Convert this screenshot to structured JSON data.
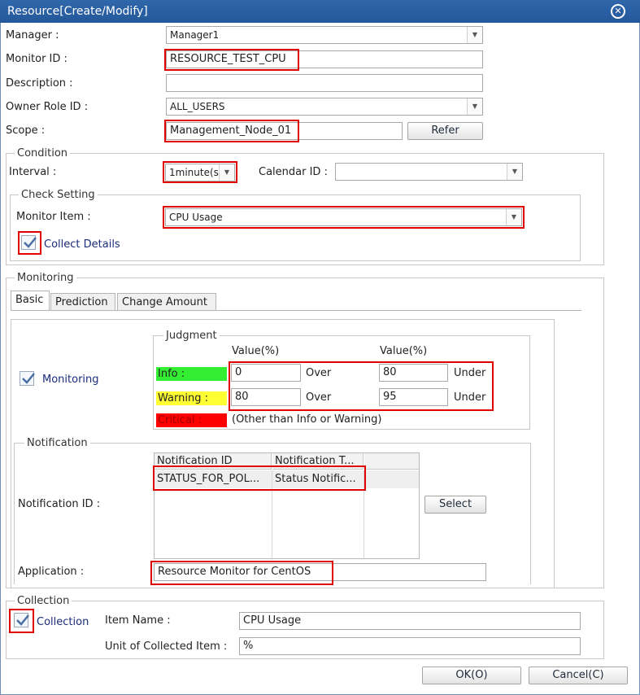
{
  "window": {
    "title": "Resource[Create/Modify]"
  },
  "form": {
    "manager_label": "Manager :",
    "manager_value": "Manager1",
    "monitor_id_label": "Monitor ID :",
    "monitor_id_value": "RESOURCE_TEST_CPU",
    "description_label": "Description :",
    "description_value": "",
    "owner_role_label": "Owner Role ID :",
    "owner_role_value": "ALL_USERS",
    "scope_label": "Scope :",
    "scope_value": "Management_Node_01",
    "refer_label": "Refer"
  },
  "condition": {
    "legend": "Condition",
    "interval_label": "Interval :",
    "interval_value": "1minute(s",
    "calendar_label": "Calendar ID :",
    "calendar_value": "",
    "check_setting": {
      "legend": "Check Setting",
      "monitor_item_label": "Monitor Item :",
      "monitor_item_value": "CPU Usage",
      "collect_details_label": "Collect Details",
      "collect_details_checked": true
    }
  },
  "monitoring": {
    "legend": "Monitoring",
    "tabs": [
      {
        "label": "Basic",
        "active": true
      },
      {
        "label": "Prediction",
        "active": false
      },
      {
        "label": "Change Amount",
        "active": false
      }
    ],
    "monitoring_label": "Monitoring",
    "monitoring_checked": true,
    "judgment": {
      "legend": "Judgment",
      "col1_header": "Value(%)",
      "col2_header": "Value(%)",
      "info_label": "Info :",
      "info_lower": "0",
      "info_over": "Over",
      "info_upper": "80",
      "info_under": "Under",
      "warning_label": "Warning :",
      "warning_lower": "80",
      "warning_over": "Over",
      "warning_upper": "95",
      "warning_under": "Under",
      "critical_label": "Critical :",
      "critical_note": "(Other than Info or Warning)",
      "colors": {
        "info": "#33ee33",
        "warning": "#ffff33",
        "critical": "#ff0000"
      }
    },
    "notification": {
      "legend": "Notification",
      "notification_id_label": "Notification ID :",
      "columns": [
        "Notification ID",
        "Notification T..."
      ],
      "rows": [
        {
          "id": "STATUS_FOR_POL...",
          "type": "Status Notific..."
        }
      ],
      "select_label": "Select",
      "application_label": "Application :",
      "application_value": "Resource Monitor for CentOS"
    }
  },
  "collection": {
    "legend": "Collection",
    "collection_label": "Collection",
    "collection_checked": true,
    "item_name_label": "Item Name :",
    "item_name_value": "CPU Usage",
    "unit_label": "Unit of Collected Item :",
    "unit_value": "%"
  },
  "footer": {
    "ok_label": "OK(O)",
    "cancel_label": "Cancel(C)"
  },
  "icons": {
    "close": "close-circle-icon",
    "dropdown": "chevron-down-icon",
    "check": "checkmark-icon"
  }
}
